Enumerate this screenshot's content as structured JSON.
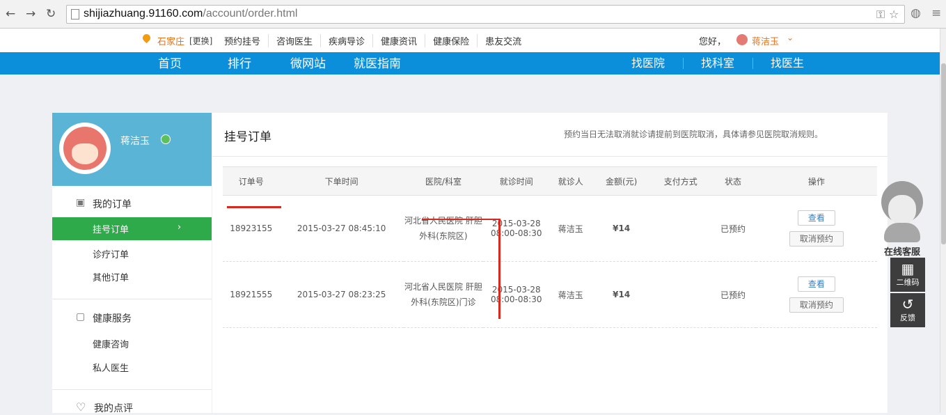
{
  "browser": {
    "back_icon": "←",
    "forward_icon": "→",
    "reload_icon": "↻",
    "url_domain": "shijiazhuang.91160.com",
    "url_path": "/account/order.html",
    "key_icon": "⚿",
    "star_icon": "☆",
    "globe_icon": "◍",
    "menu_icon": "≡"
  },
  "topbar": {
    "city": "石家庄",
    "change": "[更换]",
    "links": [
      "预约挂号",
      "咨询医生",
      "疾病导诊",
      "健康资讯",
      "健康保险",
      "患友交流"
    ],
    "greeting": "您好，",
    "username": "蒋洁玉",
    "caret": "⌄"
  },
  "nav": {
    "left": [
      "首页",
      "排行",
      "微网站",
      "就医指南"
    ],
    "right": [
      "找医院",
      "找科室",
      "找医生"
    ]
  },
  "sidebar": {
    "profile_name": "蒋洁玉",
    "section1_title": "我的订单",
    "section1_icon": "▣",
    "active_item": "挂号订单",
    "active_arrow": "›",
    "section1_items": [
      "诊疗订单",
      "其他订单"
    ],
    "section2_title": "健康服务",
    "section2_icon": "▢",
    "section2_items": [
      "健康咨询",
      "私人医生"
    ],
    "section3_title": "我的点评",
    "section3_icon": "♡"
  },
  "main": {
    "title": "挂号订单",
    "note": "预约当日无法取消就诊请提前到医院取消，具体请参见医院取消规则。",
    "columns": [
      "订单号",
      "下单时间",
      "医院/科室",
      "就诊时间",
      "就诊人",
      "金额(元)",
      "支付方式",
      "状态",
      "操作"
    ],
    "rows": [
      {
        "order_id": "18923155",
        "created": "2015-03-27 08:45:10",
        "dept": "河北省人民医院 肝胆外科(东院区)",
        "visit_time": "2015-03-28 08:00-08:30",
        "patient": "蒋洁玉",
        "amount": "¥14",
        "pay": "",
        "status": "已预约",
        "view": "查看",
        "cancel": "取消预约"
      },
      {
        "order_id": "18921555",
        "created": "2015-03-27 08:23:25",
        "dept": "河北省人民医院 肝胆外科(东院区)门诊",
        "visit_time": "2015-03-28 08:00-08:30",
        "patient": "蒋洁玉",
        "amount": "¥14",
        "pay": "",
        "status": "已预约",
        "view": "查看",
        "cancel": "取消预约"
      }
    ]
  },
  "widget": {
    "cs_label": "在线客服",
    "qr_icon": "▦",
    "qr_label": "二维码",
    "feedback_icon": "↺",
    "feedback_label": "反馈"
  },
  "colors": {
    "nav_blue": "#0b8fdb",
    "active_green": "#2eaa4a",
    "profile_blue": "#5ab4d6",
    "accent_orange": "#e6731e",
    "amount_red": "#d9281e"
  }
}
